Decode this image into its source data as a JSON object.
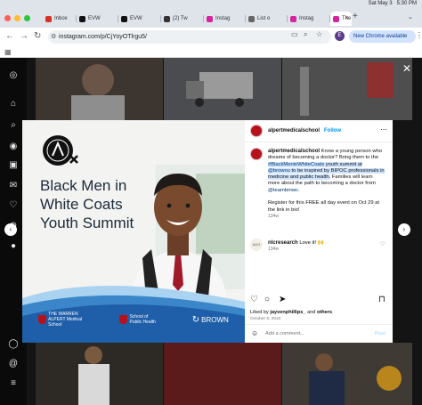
{
  "system": {
    "date": "Sat May 3",
    "time": "5:30 PM"
  },
  "tabs": [
    {
      "label": "Inbox",
      "fav": "#d93025"
    },
    {
      "label": "EVW",
      "fav": "#111111"
    },
    {
      "label": "EVW",
      "fav": "#111111"
    },
    {
      "label": "(2) Tw",
      "fav": "#333333"
    },
    {
      "label": "Instag",
      "fav": "#d6249f"
    },
    {
      "label": "List o",
      "fav": "#666666"
    },
    {
      "label": "Instag",
      "fav": "#d6249f"
    },
    {
      "label": "The V",
      "fav": "#d6249f"
    }
  ],
  "address": {
    "url": "instagram.com/p/CjYoyOTlrgu5/"
  },
  "profile_initial": "E",
  "update_button": "New Chrome available",
  "post": {
    "image_title": "Black Men in White Coats Youth Summit",
    "logo_badge": "Black Men in White Coats",
    "logo_1": "THE WARREN ALPERT Medical School",
    "logo_2": "School of Public Health",
    "logo_3": "BROWN"
  },
  "side": {
    "username": "alpertmedicalschool",
    "follow": "Follow",
    "caption": {
      "user": "alpertmedicalschool",
      "text1": " Know a young person who dreams of becoming a doctor? Bring them to the ",
      "hashtag": "#BlackMeninWhiteCoats",
      "text2": " youth summit at ",
      "mention": "@brownu",
      "text3": " to be inspired by BIPOC professionals in medicine and public health.",
      "text4": " Families will learn more about the path to becoming a doctor from ",
      "mention2": "@teambmwc",
      "text5": ".",
      "text6": "Register for this FREE all day event on Oct 29 at the link in bio!",
      "time": "134w"
    },
    "comment": {
      "user": "nlcresearch",
      "text": "Love it! 🙌",
      "time": "134w",
      "avatar_text": "ADO"
    },
    "likes_prefix": "Liked by ",
    "likes_user": "jayvenphillips_",
    "likes_mid": " and ",
    "likes_others": "others",
    "date": "October 6, 2022",
    "add_comment": "Add a comment...",
    "post_btn": "Post"
  },
  "colors": {
    "brand_red": "#b5121b",
    "link_blue": "#0095f6",
    "wave_blue": "#3a86c8"
  }
}
